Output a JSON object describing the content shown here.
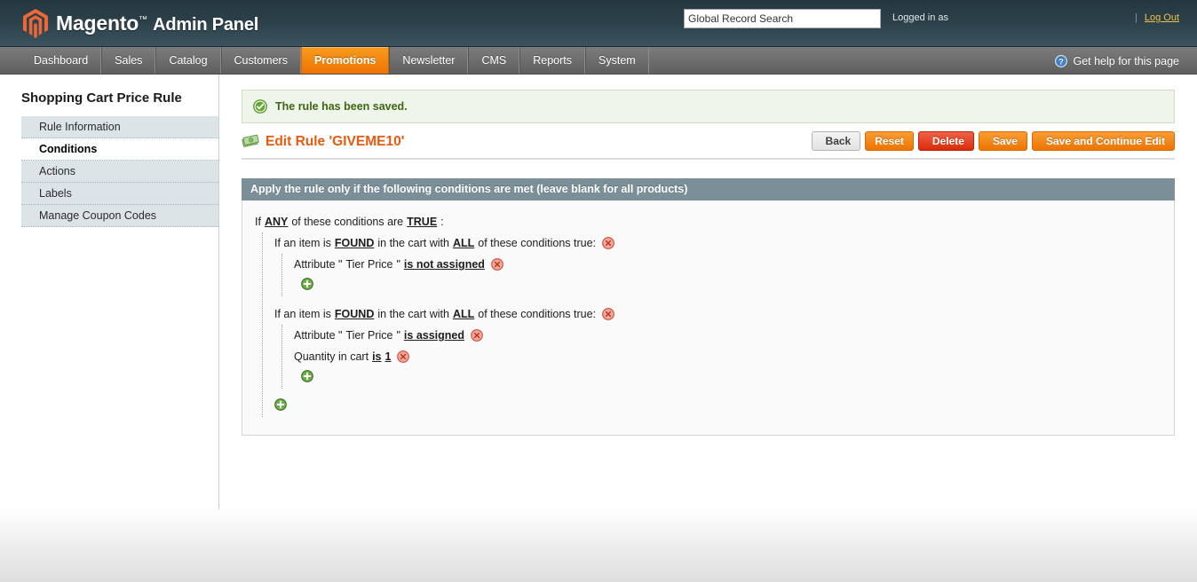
{
  "header": {
    "logo_icon": "magento-logo-icon",
    "brand": "Magento",
    "brand_tm": "™",
    "brand_sub": "Admin Panel",
    "search_value": "Global Record Search",
    "search_placeholder": "Global Record Search",
    "logged_in_as": "Logged in as",
    "separator": "|",
    "logout_label": "Log Out"
  },
  "nav": {
    "items": [
      {
        "label": "Dashboard",
        "active": false
      },
      {
        "label": "Sales",
        "active": false
      },
      {
        "label": "Catalog",
        "active": false
      },
      {
        "label": "Customers",
        "active": false
      },
      {
        "label": "Promotions",
        "active": true
      },
      {
        "label": "Newsletter",
        "active": false
      },
      {
        "label": "CMS",
        "active": false
      },
      {
        "label": "Reports",
        "active": false
      },
      {
        "label": "System",
        "active": false
      }
    ],
    "help_icon": "question-circle-icon",
    "help_label": "Get help for this page"
  },
  "sidebar": {
    "title": "Shopping Cart Price Rule",
    "items": [
      {
        "label": "Rule Information",
        "active": false
      },
      {
        "label": "Conditions",
        "active": true
      },
      {
        "label": "Actions",
        "active": false
      },
      {
        "label": "Labels",
        "active": false
      },
      {
        "label": "Manage Coupon Codes",
        "active": false
      }
    ]
  },
  "message": {
    "icon": "success-check-icon",
    "text": "The rule has been saved."
  },
  "page": {
    "title_icon": "money-bills-icon",
    "title": "Edit Rule 'GIVEME10'"
  },
  "buttons": [
    {
      "label": "Back",
      "style": "back",
      "icon": "arrow-left-circle-icon"
    },
    {
      "label": "Reset",
      "style": "orange",
      "icon": ""
    },
    {
      "label": "Delete",
      "style": "red",
      "icon": "x-circle-icon"
    },
    {
      "label": "Save",
      "style": "orange",
      "icon": "check-circle-icon"
    },
    {
      "label": "Save and Continue Edit",
      "style": "orange",
      "icon": "check-circle-icon"
    }
  ],
  "conditions_panel": {
    "heading": "Apply the rule only if the following conditions are met (leave blank for all products)",
    "root": {
      "prefix": "If",
      "aggregator": "ANY",
      "middle": "of these conditions are",
      "value": "TRUE",
      "suffix": ":"
    },
    "groups": [
      {
        "prefix": "If an item is",
        "found": "FOUND",
        "middle": "in the cart with",
        "all": "ALL",
        "suffix": "of these conditions true:",
        "delete_icon": "delete-circle-icon",
        "rows": [
          {
            "prefix": "Attribute \"",
            "attribute": "Tier Price",
            "mid": "\"",
            "operator": "is not assigned",
            "value": "",
            "delete_icon": "delete-circle-icon"
          }
        ],
        "add_icon": "add-circle-icon"
      },
      {
        "prefix": "If an item is",
        "found": "FOUND",
        "middle": "in the cart with",
        "all": "ALL",
        "suffix": "of these conditions true:",
        "delete_icon": "delete-circle-icon",
        "rows": [
          {
            "prefix": "Attribute \"",
            "attribute": "Tier Price",
            "mid": "\"",
            "operator": "is assigned",
            "value": "",
            "delete_icon": "delete-circle-icon"
          },
          {
            "prefix": "Quantity in cart",
            "attribute": "",
            "mid": "",
            "operator": "is",
            "value": "1",
            "delete_icon": "delete-circle-icon"
          }
        ],
        "add_icon": "add-circle-icon"
      }
    ],
    "root_add_icon": "add-circle-icon"
  },
  "colors": {
    "brand_orange": "#ed7403",
    "header_dark": "#2b4049",
    "nav_gray": "#6e6e6e",
    "panel_head": "#7b8f99",
    "success_bg": "#eff5ea",
    "success_text": "#3d6611",
    "title_orange": "#e75b10",
    "delete_red": "#d92b0b",
    "add_green": "#4d8f2c",
    "logout_yellow": "#f0c14b",
    "sidebar_item_bg": "#dde4e8"
  }
}
